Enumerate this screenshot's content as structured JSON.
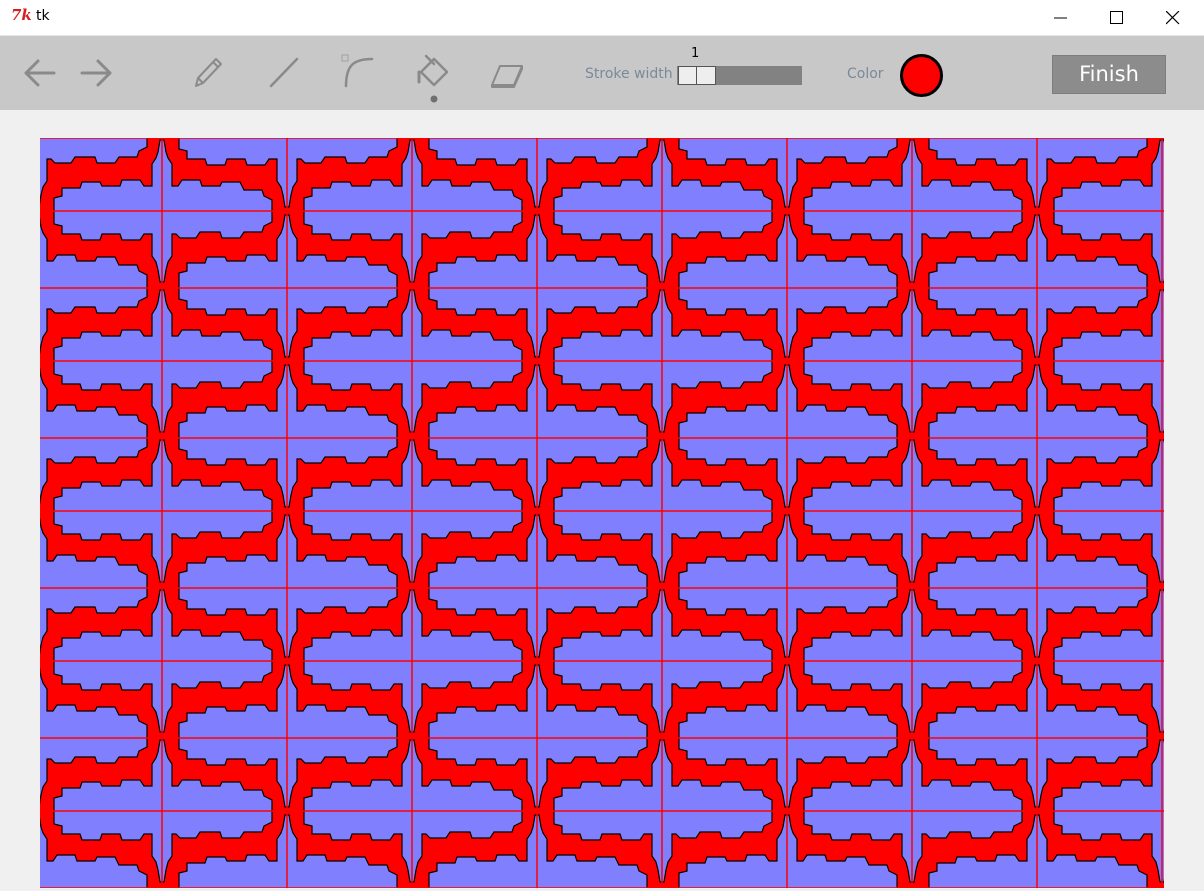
{
  "window": {
    "title": "tk",
    "icon": "tk-feather-icon",
    "logo_text": "7k"
  },
  "toolbar": {
    "tools": [
      {
        "name": "undo",
        "icon": "arrow-left-icon"
      },
      {
        "name": "redo",
        "icon": "arrow-right-icon"
      },
      {
        "name": "pencil",
        "icon": "pencil-icon"
      },
      {
        "name": "line",
        "icon": "line-icon"
      },
      {
        "name": "curve",
        "icon": "curve-icon"
      },
      {
        "name": "fill",
        "icon": "paint-bucket-icon",
        "selected": true
      },
      {
        "name": "eraser",
        "icon": "eraser-icon"
      }
    ],
    "stroke_width_label": "Stroke width",
    "stroke_width_value": "1",
    "stroke_width_level": 0.0,
    "color_label": "Color",
    "color_value": "#ff0000",
    "finish_label": "Finish"
  },
  "canvas": {
    "background_color": "#ff0000",
    "shape_fill": "#8080ff",
    "shape_stroke": "#000000",
    "line_color": "#ff0000"
  }
}
